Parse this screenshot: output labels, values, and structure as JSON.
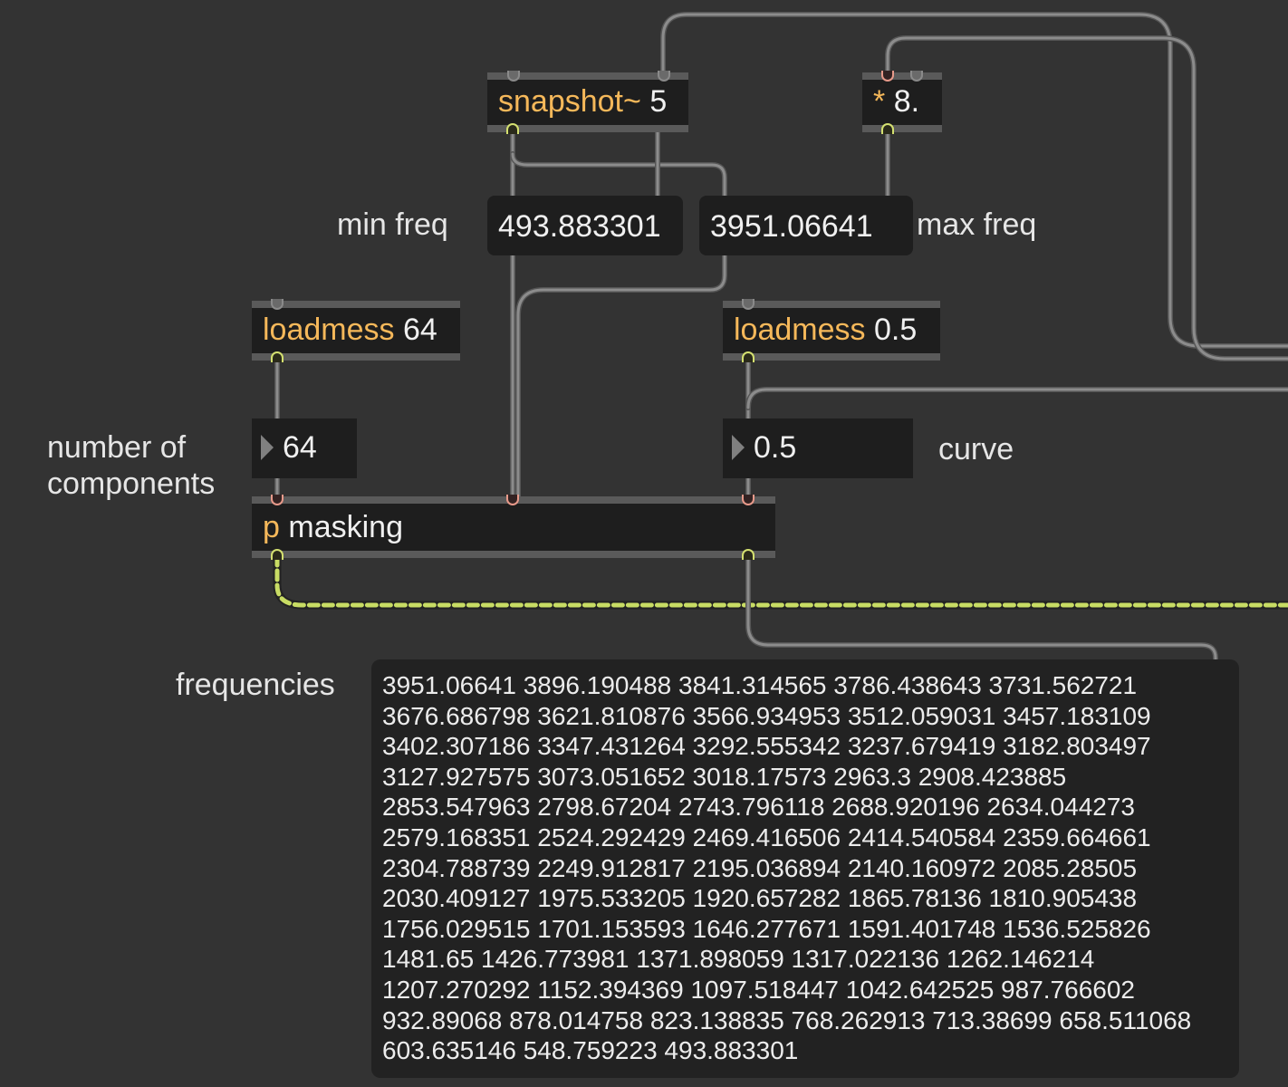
{
  "objects": {
    "snapshot": {
      "class_name": "snapshot~",
      "args": "5"
    },
    "multiply": {
      "class_name": "*",
      "args": "8."
    },
    "loadmess_components": {
      "class_name": "loadmess",
      "args": "64"
    },
    "loadmess_curve": {
      "class_name": "loadmess",
      "args": "0.5"
    },
    "p_masking": {
      "class_name": "p",
      "args": "masking"
    }
  },
  "number_boxes": {
    "min_freq": "493.883301",
    "max_freq": "3951.06641",
    "components": "64",
    "curve": "0.5"
  },
  "comments": {
    "min_freq": "min freq",
    "max_freq": "max freq",
    "number_of_components_line1": "number of",
    "number_of_components_line2": "components",
    "curve": "curve",
    "frequencies": "frequencies"
  },
  "frequencies_message": "3951.06641 3896.190488 3841.314565 3786.438643 3731.562721 3676.686798 3621.810876 3566.934953 3512.059031 3457.183109 3402.307186 3347.431264 3292.555342 3237.679419 3182.803497 3127.927575 3073.051652 3018.17573 2963.3 2908.423885 2853.547963 2798.67204 2743.796118 2688.920196 2634.044273 2579.168351 2524.292429 2469.416506 2414.540584 2359.664661 2304.788739 2249.912817 2195.036894 2140.160972 2085.28505 2030.409127 1975.533205 1920.657282 1865.78136 1810.905438 1756.029515 1701.153593 1646.277671 1591.401748 1536.525826 1481.65 1426.773981 1371.898059 1317.022136 1262.146214 1207.270292 1152.394369 1097.518447 1042.642525 987.766602 932.89068 878.014758 823.138835 768.262913 713.38699 658.511068 603.635146 548.759223 493.883301",
  "colors": {
    "canvas": "#333333",
    "object_body": "#1e1e1e",
    "object_class_text": "#f5b85a",
    "patch_cord": "#8c8c8c",
    "signal_cord": "#c8dc64",
    "outlet": "#d4e070",
    "hot_inlet": "#e89a8a"
  }
}
